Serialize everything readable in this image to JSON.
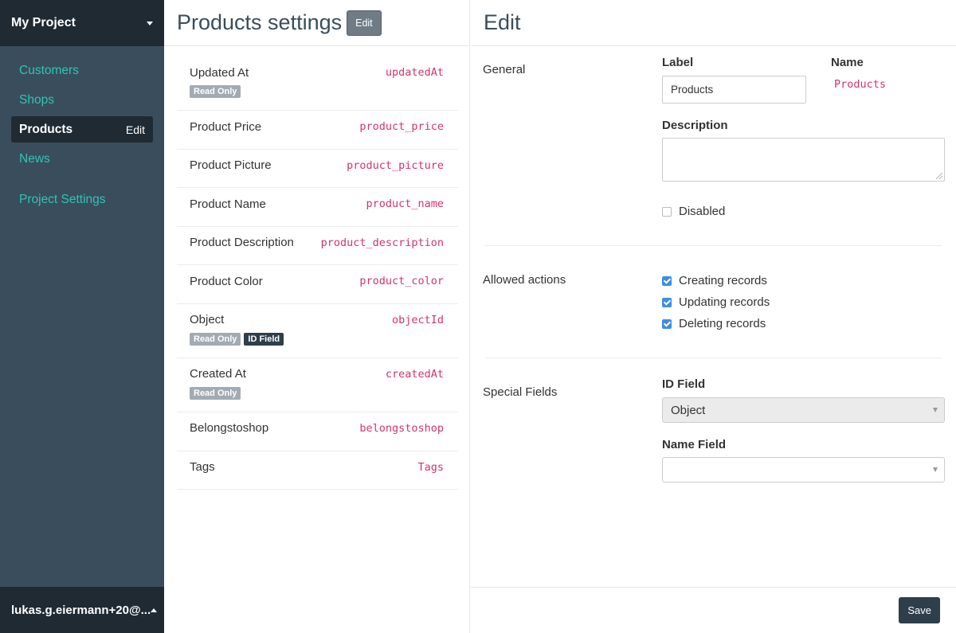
{
  "sidebar": {
    "project_name": "My Project",
    "items": [
      {
        "label": "Customers"
      },
      {
        "label": "Shops"
      },
      {
        "label": "Products",
        "edit": "Edit"
      },
      {
        "label": "News"
      }
    ],
    "settings_label": "Project Settings",
    "user": "lukas.g.eiermann+20@..."
  },
  "middle": {
    "title": "Products settings",
    "edit_label": "Edit",
    "fields": [
      {
        "label": "Updated At",
        "key": "updatedAt",
        "badges": [
          "Read Only"
        ]
      },
      {
        "label": "Product Price",
        "key": "product_price",
        "badges": []
      },
      {
        "label": "Product Picture",
        "key": "product_picture",
        "badges": []
      },
      {
        "label": "Product Name",
        "key": "product_name",
        "badges": []
      },
      {
        "label": "Product Description",
        "key": "product_description",
        "badges": []
      },
      {
        "label": "Product Color",
        "key": "product_color",
        "badges": []
      },
      {
        "label": "Object",
        "key": "objectId",
        "badges": [
          "Read Only",
          "ID Field"
        ]
      },
      {
        "label": "Created At",
        "key": "createdAt",
        "badges": [
          "Read Only"
        ]
      },
      {
        "label": "Belongstoshop",
        "key": "belongstoshop",
        "badges": []
      },
      {
        "label": "Tags",
        "key": "Tags",
        "badges": []
      }
    ]
  },
  "edit": {
    "title": "Edit",
    "general": {
      "section_label": "General",
      "label_label": "Label",
      "label_value": "Products",
      "name_label": "Name",
      "name_value": "Products",
      "description_label": "Description",
      "description_value": "",
      "disabled_label": "Disabled",
      "disabled_checked": false
    },
    "allowed_actions": {
      "section_label": "Allowed actions",
      "options": [
        {
          "label": "Creating records",
          "checked": true
        },
        {
          "label": "Updating records",
          "checked": true
        },
        {
          "label": "Deleting records",
          "checked": true
        }
      ]
    },
    "special_fields": {
      "section_label": "Special Fields",
      "id_field_label": "ID Field",
      "id_field_value": "Object",
      "name_field_label": "Name Field",
      "name_field_value": ""
    },
    "save_label": "Save"
  },
  "colors": {
    "sidebar_bg": "#3a4d5c",
    "sidebar_dark": "#1f2a33",
    "accent_teal": "#2ec4b6",
    "key_pink": "#d6336c",
    "checkbox_blue": "#3b8ee8"
  }
}
